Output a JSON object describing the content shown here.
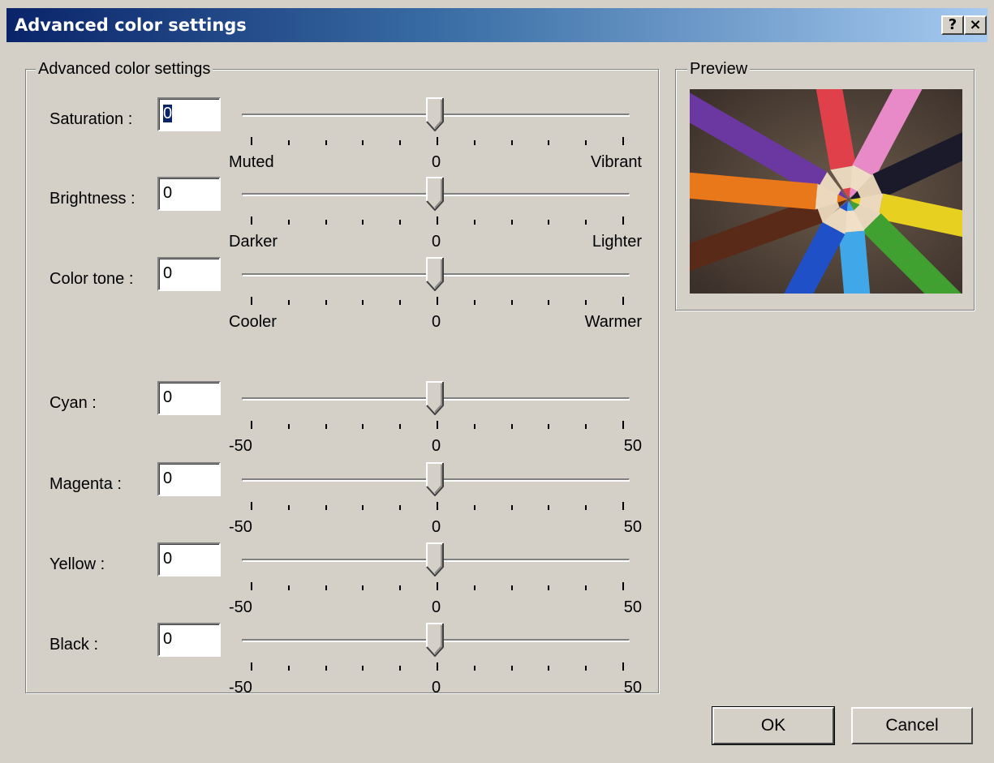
{
  "window": {
    "title": "Advanced color settings",
    "help_glyph": "?",
    "close_glyph": "×"
  },
  "group": {
    "label": "Advanced color settings"
  },
  "preview": {
    "label": "Preview",
    "image": "colored-pencils-photo"
  },
  "sliders": [
    {
      "label": "Saturation :",
      "value": "0",
      "min_label": "Muted",
      "mid_label": "0",
      "max_label": "Vibrant",
      "position": 0.5,
      "selected": true
    },
    {
      "label": "Brightness :",
      "value": "0",
      "min_label": "Darker",
      "mid_label": "0",
      "max_label": "Lighter",
      "position": 0.5
    },
    {
      "label": "Color tone :",
      "value": "0",
      "min_label": "Cooler",
      "mid_label": "0",
      "max_label": "Warmer",
      "position": 0.5
    },
    {
      "label": "Cyan :",
      "value": "0",
      "min_label": "-50",
      "mid_label": "0",
      "max_label": "50",
      "position": 0.5
    },
    {
      "label": "Magenta :",
      "value": "0",
      "min_label": "-50",
      "mid_label": "0",
      "max_label": "50",
      "position": 0.5
    },
    {
      "label": "Yellow :",
      "value": "0",
      "min_label": "-50",
      "mid_label": "0",
      "max_label": "50",
      "position": 0.5
    },
    {
      "label": "Black :",
      "value": "0",
      "min_label": "-50",
      "mid_label": "0",
      "max_label": "50",
      "position": 0.5
    }
  ],
  "buttons": {
    "ok": "OK",
    "cancel": "Cancel"
  },
  "colors": {
    "dialog_bg": "#d4d0c8",
    "title_start": "#0a246a",
    "title_end": "#a6caf0",
    "selection": "#0a246a"
  }
}
